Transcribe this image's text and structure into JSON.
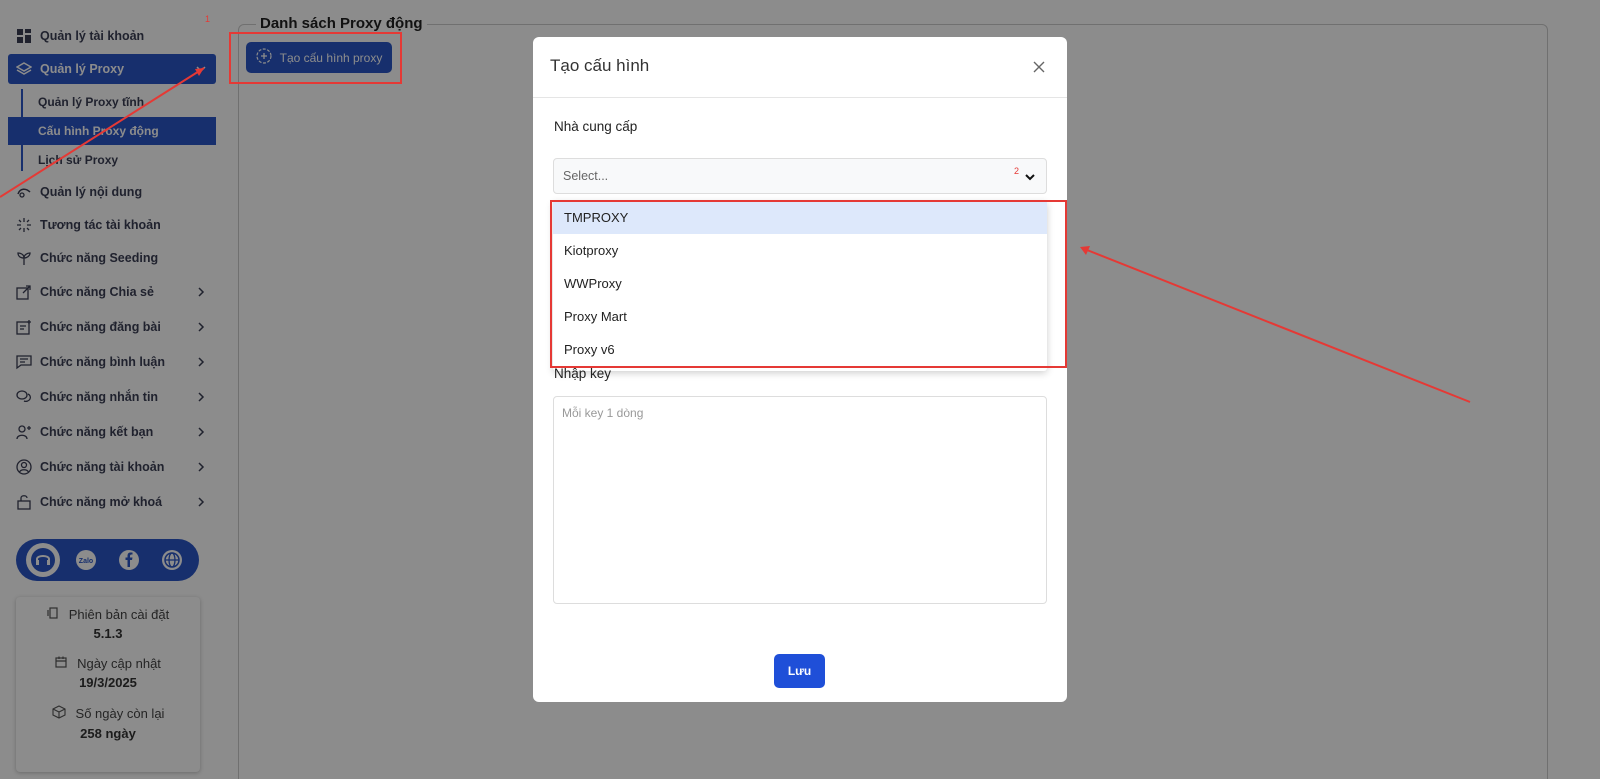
{
  "sidebar": {
    "items": [
      {
        "label": "Quản lý tài khoản",
        "icon": "grid-icon"
      },
      {
        "label": "Quản lý Proxy",
        "icon": "layers-icon"
      },
      {
        "label": "Quản lý nội dung",
        "icon": "content-icon"
      },
      {
        "label": "Tương tác tài khoản",
        "icon": "sparkle-icon"
      },
      {
        "label": "Chức năng Seeding",
        "icon": "sprout-icon"
      },
      {
        "label": "Chức năng Chia sẻ",
        "icon": "share-icon"
      },
      {
        "label": "Chức năng đăng bài",
        "icon": "post-icon"
      },
      {
        "label": "Chức năng bình luận",
        "icon": "comment-icon"
      },
      {
        "label": "Chức năng nhắn tin",
        "icon": "message-icon"
      },
      {
        "label": "Chức năng kết bạn",
        "icon": "add-friend-icon"
      },
      {
        "label": "Chức năng tài khoản",
        "icon": "user-circle-icon"
      },
      {
        "label": "Chức năng mở khoá",
        "icon": "lock-icon"
      }
    ],
    "sub_items": [
      {
        "label": "Quản lý Proxy tĩnh"
      },
      {
        "label": "Cấu hình Proxy động"
      },
      {
        "label": "Lịch sử Proxy"
      }
    ],
    "info": {
      "version_label": "Phiên bản cài đặt",
      "version_value": "5.1.3",
      "updated_label": "Ngày cập nhật",
      "updated_value": "19/3/2025",
      "remaining_label": "Số ngày còn lại",
      "remaining_value": "258 ngày"
    }
  },
  "main": {
    "title": "Danh sách Proxy động",
    "create_button": "Tạo cấu hình proxy"
  },
  "modal": {
    "title": "Tạo cấu hình",
    "provider_label": "Nhà cung cấp",
    "select_placeholder": "Select...",
    "options": [
      "TMPROXY",
      "Kiotproxy",
      "WWProxy",
      "Proxy Mart",
      "Proxy v6"
    ],
    "highlighted_option": "TMPROXY",
    "key_label": "Nhập key",
    "key_placeholder": "Mỗi key 1 dòng",
    "save_button": "Lưu"
  },
  "annotations": {
    "marker_1": "1",
    "marker_2": "2"
  },
  "colors": {
    "accent": "#2a56c6",
    "annotation": "#e53935",
    "highlight": "#dde8fb"
  }
}
